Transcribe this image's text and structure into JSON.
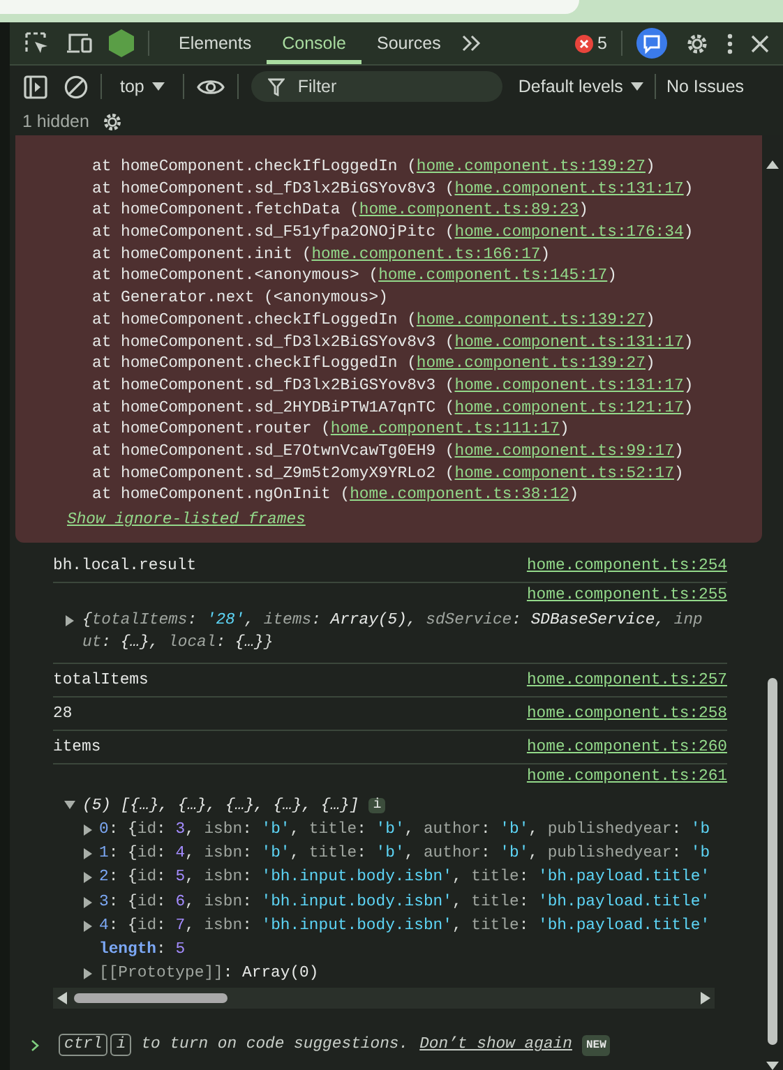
{
  "tabs": [
    {
      "label": "Elements",
      "selected": false
    },
    {
      "label": "Console",
      "selected": true
    },
    {
      "label": "Sources",
      "selected": false
    }
  ],
  "error_count": "5",
  "toolbar": {
    "context": "top",
    "filter_placeholder": "Filter",
    "levels": "Default levels",
    "issues": "No Issues"
  },
  "hidden": "1 hidden",
  "error": {
    "frames": [
      {
        "text": "at homeComponent.checkIfLoggedIn (",
        "link": "home.component.ts:139:27",
        "end": ")"
      },
      {
        "text": "at homeComponent.sd_fD3lx2BiGSYov8v3 (",
        "link": "home.component.ts:131:17",
        "end": ")"
      },
      {
        "text": "at homeComponent.fetchData (",
        "link": "home.component.ts:89:23",
        "end": ")"
      },
      {
        "text": "at homeComponent.sd_F51yfpa2ONOjPitc (",
        "link": "home.component.ts:176:34",
        "end": ")"
      },
      {
        "text": "at homeComponent.init (",
        "link": "home.component.ts:166:17",
        "end": ")"
      },
      {
        "text": "at homeComponent.<anonymous> (",
        "link": "home.component.ts:145:17",
        "end": ")"
      },
      {
        "text": "at Generator.next (<anonymous>)"
      },
      {
        "text": "at homeComponent.checkIfLoggedIn (",
        "link": "home.component.ts:139:27",
        "end": ")"
      },
      {
        "text": "at homeComponent.sd_fD3lx2BiGSYov8v3 (",
        "link": "home.component.ts:131:17",
        "end": ")"
      },
      {
        "text": "at homeComponent.checkIfLoggedIn (",
        "link": "home.component.ts:139:27",
        "end": ")"
      },
      {
        "text": "at homeComponent.sd_fD3lx2BiGSYov8v3 (",
        "link": "home.component.ts:131:17",
        "end": ")"
      },
      {
        "text": "at homeComponent.sd_2HYDBiPTW1A7qnTC (",
        "link": "home.component.ts:121:17",
        "end": ")"
      },
      {
        "text": "at homeComponent.router (",
        "link": "home.component.ts:111:17",
        "end": ")"
      },
      {
        "text": "at homeComponent.sd_E7OtwnVcawTg0EH9 (",
        "link": "home.component.ts:99:17",
        "end": ")"
      },
      {
        "text": "at homeComponent.sd_Z9m5t2omyX9YRLo2 (",
        "link": "home.component.ts:52:17",
        "end": ")"
      },
      {
        "text": "at homeComponent.ngOnInit (",
        "link": "home.component.ts:38:12",
        "end": ")"
      }
    ],
    "show_frames": "Show ignore-listed frames"
  },
  "messages": [
    {
      "kind": "text",
      "text": "bh.local.result",
      "source": "home.component.ts:254"
    },
    {
      "kind": "object",
      "source": "home.component.ts:255",
      "expanded": false,
      "parts": [
        {
          "kind": "punct",
          "text": "{"
        },
        {
          "kind": "key",
          "text": "totalItems"
        },
        {
          "kind": "punct",
          "text": ": "
        },
        {
          "kind": "string",
          "text": "'28'"
        },
        {
          "kind": "punct",
          "text": ", "
        },
        {
          "kind": "key",
          "text": "items"
        },
        {
          "kind": "punct",
          "text": ": "
        },
        {
          "kind": "plain",
          "text": "Array(5)"
        },
        {
          "kind": "punct",
          "text": ", "
        },
        {
          "kind": "key",
          "text": "sdService"
        },
        {
          "kind": "punct",
          "text": ": "
        },
        {
          "kind": "plain",
          "text": "SDBaseService"
        },
        {
          "kind": "punct",
          "text": ", "
        },
        {
          "kind": "key",
          "text": "input"
        },
        {
          "kind": "punct",
          "text": ": "
        },
        {
          "kind": "plain",
          "text": "{…}"
        },
        {
          "kind": "punct",
          "text": ", "
        },
        {
          "kind": "key",
          "text": "local"
        },
        {
          "kind": "punct",
          "text": ": "
        },
        {
          "kind": "plain",
          "text": "{…}"
        },
        {
          "kind": "punct",
          "text": "}"
        }
      ]
    },
    {
      "kind": "text",
      "text": "totalItems",
      "source": "home.component.ts:257"
    },
    {
      "kind": "text",
      "text": "28",
      "source": "home.component.ts:258"
    },
    {
      "kind": "text",
      "text": "items",
      "source": "home.component.ts:260"
    },
    {
      "kind": "array",
      "source": "home.component.ts:261",
      "expanded": true,
      "summary": "(5) [{…}, {…}, {…}, {…}, {…}]",
      "badge": "i",
      "entries": [
        {
          "index": "0",
          "expanded": false,
          "parts": [
            {
              "kind": "punct",
              "text": ": {"
            },
            {
              "kind": "key",
              "text": "id"
            },
            {
              "kind": "punct",
              "text": ": "
            },
            {
              "kind": "number",
              "text": "3"
            },
            {
              "kind": "punct",
              "text": ", "
            },
            {
              "kind": "key",
              "text": "isbn"
            },
            {
              "kind": "punct",
              "text": ": "
            },
            {
              "kind": "string",
              "text": "'b'"
            },
            {
              "kind": "punct",
              "text": ", "
            },
            {
              "kind": "key",
              "text": "title"
            },
            {
              "kind": "punct",
              "text": ": "
            },
            {
              "kind": "string",
              "text": "'b'"
            },
            {
              "kind": "punct",
              "text": ", "
            },
            {
              "kind": "key",
              "text": "author"
            },
            {
              "kind": "punct",
              "text": ": "
            },
            {
              "kind": "string",
              "text": "'b'"
            },
            {
              "kind": "punct",
              "text": ", "
            },
            {
              "kind": "key",
              "text": "publishedyear"
            },
            {
              "kind": "punct",
              "text": ": "
            },
            {
              "kind": "string",
              "text": "'b"
            }
          ]
        },
        {
          "index": "1",
          "expanded": false,
          "parts": [
            {
              "kind": "punct",
              "text": ": {"
            },
            {
              "kind": "key",
              "text": "id"
            },
            {
              "kind": "punct",
              "text": ": "
            },
            {
              "kind": "number",
              "text": "4"
            },
            {
              "kind": "punct",
              "text": ", "
            },
            {
              "kind": "key",
              "text": "isbn"
            },
            {
              "kind": "punct",
              "text": ": "
            },
            {
              "kind": "string",
              "text": "'b'"
            },
            {
              "kind": "punct",
              "text": ", "
            },
            {
              "kind": "key",
              "text": "title"
            },
            {
              "kind": "punct",
              "text": ": "
            },
            {
              "kind": "string",
              "text": "'b'"
            },
            {
              "kind": "punct",
              "text": ", "
            },
            {
              "kind": "key",
              "text": "author"
            },
            {
              "kind": "punct",
              "text": ": "
            },
            {
              "kind": "string",
              "text": "'b'"
            },
            {
              "kind": "punct",
              "text": ", "
            },
            {
              "kind": "key",
              "text": "publishedyear"
            },
            {
              "kind": "punct",
              "text": ": "
            },
            {
              "kind": "string",
              "text": "'b"
            }
          ]
        },
        {
          "index": "2",
          "expanded": false,
          "parts": [
            {
              "kind": "punct",
              "text": ": {"
            },
            {
              "kind": "key",
              "text": "id"
            },
            {
              "kind": "punct",
              "text": ": "
            },
            {
              "kind": "number",
              "text": "5"
            },
            {
              "kind": "punct",
              "text": ", "
            },
            {
              "kind": "key",
              "text": "isbn"
            },
            {
              "kind": "punct",
              "text": ": "
            },
            {
              "kind": "string",
              "text": "'bh.input.body.isbn'"
            },
            {
              "kind": "punct",
              "text": ", "
            },
            {
              "kind": "key",
              "text": "title"
            },
            {
              "kind": "punct",
              "text": ": "
            },
            {
              "kind": "string",
              "text": "'bh.payload.title'"
            }
          ]
        },
        {
          "index": "3",
          "expanded": false,
          "parts": [
            {
              "kind": "punct",
              "text": ": {"
            },
            {
              "kind": "key",
              "text": "id"
            },
            {
              "kind": "punct",
              "text": ": "
            },
            {
              "kind": "number",
              "text": "6"
            },
            {
              "kind": "punct",
              "text": ", "
            },
            {
              "kind": "key",
              "text": "isbn"
            },
            {
              "kind": "punct",
              "text": ": "
            },
            {
              "kind": "string",
              "text": "'bh.input.body.isbn'"
            },
            {
              "kind": "punct",
              "text": ", "
            },
            {
              "kind": "key",
              "text": "title"
            },
            {
              "kind": "punct",
              "text": ": "
            },
            {
              "kind": "string",
              "text": "'bh.payload.title'"
            }
          ]
        },
        {
          "index": "4",
          "expanded": false,
          "parts": [
            {
              "kind": "punct",
              "text": ": {"
            },
            {
              "kind": "key",
              "text": "id"
            },
            {
              "kind": "punct",
              "text": ": "
            },
            {
              "kind": "number",
              "text": "7"
            },
            {
              "kind": "punct",
              "text": ", "
            },
            {
              "kind": "key",
              "text": "isbn"
            },
            {
              "kind": "punct",
              "text": ": "
            },
            {
              "kind": "string",
              "text": "'bh.input.body.isbn'"
            },
            {
              "kind": "punct",
              "text": ", "
            },
            {
              "kind": "key",
              "text": "title"
            },
            {
              "kind": "punct",
              "text": ": "
            },
            {
              "kind": "string",
              "text": "'bh.payload.title'"
            }
          ]
        }
      ],
      "length_key": "length",
      "length_separator": ": ",
      "length_value": "5",
      "prototype_key": "[[Prototype]]",
      "prototype_separator": ": ",
      "prototype_value": "Array(0)",
      "prototype_expanded": false
    }
  ],
  "prompt": {
    "keys": [
      "ctrl",
      "i"
    ],
    "text": "to turn on code suggestions.",
    "link": "Don’t show again",
    "badge": "NEW"
  }
}
